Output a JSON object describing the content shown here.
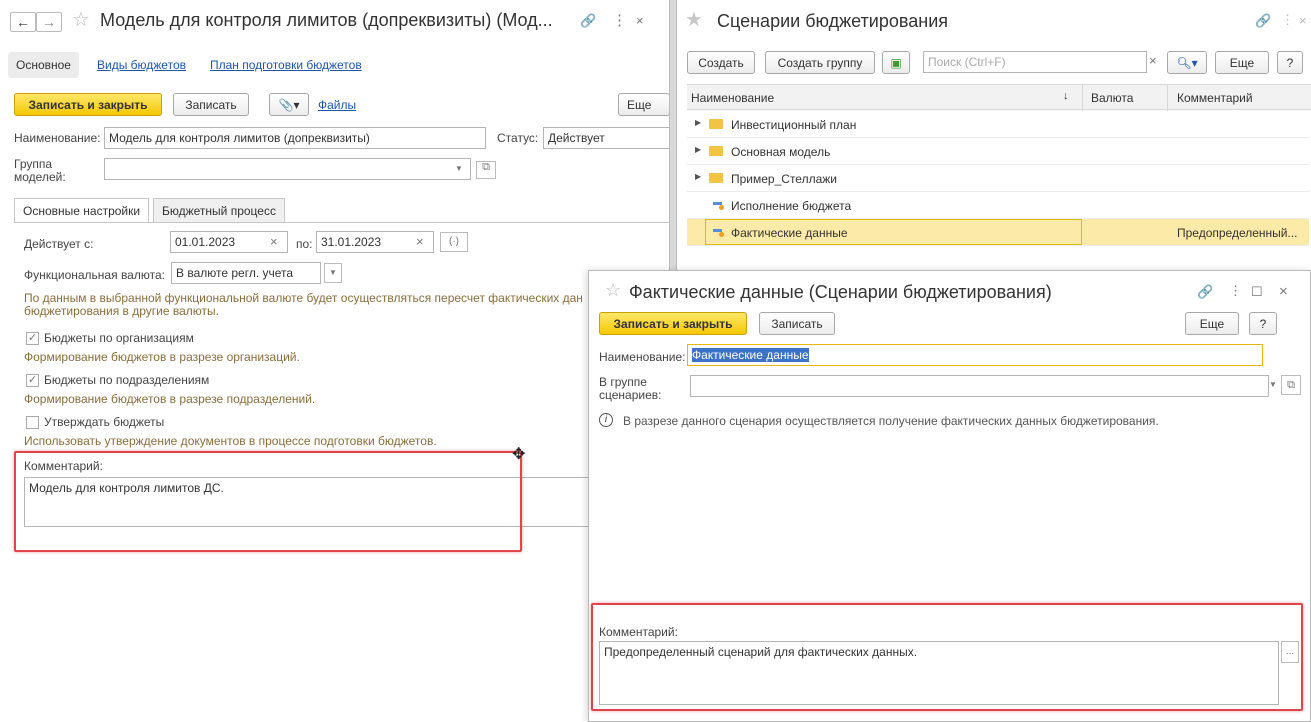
{
  "model_window": {
    "title": "Модель для контроля лимитов (допреквизиты) (Мод...",
    "nav_tabs": [
      "Основное",
      "Виды бюджетов",
      "План подготовки бюджетов"
    ],
    "toolbar": {
      "save_close": "Записать и закрыть",
      "save": "Записать",
      "files": "Файлы",
      "more": "Еще"
    },
    "name_label": "Наименование:",
    "name_value": "Модель для контроля лимитов (допреквизиты)",
    "status_label": "Статус:",
    "status_value": "Действует",
    "group_label_1": "Группа",
    "group_label_2": "моделей:",
    "group_value": "",
    "tabs": [
      "Основные настройки",
      "Бюджетный процесс"
    ],
    "active_from_label": "Действует с:",
    "date_from": "01.01.2023",
    "to_label": "по:",
    "date_to": "31.01.2023",
    "currency_label": "Функциональная валюта:",
    "currency_value": "В валюте регл. учета",
    "currency_hint_1": "По данным в выбранной функциональной валюте будет осуществляться пересчет фактических дан",
    "currency_hint_2": "бюджетирования в другие валюты.",
    "check_orgs_label": "Бюджеты по организациям",
    "check_orgs_hint": "Формирование бюджетов в разрезе организаций.",
    "check_depts_label": "Бюджеты по подразделениям",
    "check_depts_hint": "Формирование бюджетов в разрезе подразделений.",
    "check_approve_label": "Утверждать бюджеты",
    "check_approve_hint": "Использовать утверждение документов в процессе подготовки бюджетов.",
    "comment_label": "Комментарий:",
    "comment_value": "Модель для контроля лимитов ДС."
  },
  "scenarios_window": {
    "title": "Сценарии бюджетирования",
    "toolbar": {
      "create": "Создать",
      "create_group": "Создать группу",
      "search_placeholder": "Поиск (Ctrl+F)",
      "more": "Еще",
      "help": "?"
    },
    "columns": [
      "Наименование",
      "Валюта",
      "Комментарий"
    ],
    "rows": [
      {
        "name": "Инвестиционный план",
        "currency": "",
        "comment": ""
      },
      {
        "name": "Основная модель",
        "currency": "",
        "comment": ""
      },
      {
        "name": "Пример_Стеллажи",
        "currency": "",
        "comment": ""
      },
      {
        "name": "Исполнение бюджета",
        "currency": "",
        "comment": ""
      },
      {
        "name": "Фактические данные",
        "currency": "",
        "comment": "Предопределенный..."
      }
    ]
  },
  "fact_window": {
    "title": "Фактические данные (Сценарии бюджетирования)",
    "toolbar": {
      "save_close": "Записать и закрыть",
      "save": "Записать",
      "more": "Еще",
      "help": "?"
    },
    "name_label": "Наименование:",
    "name_value": "Фактические данные",
    "group_label_1": "В группе",
    "group_label_2": "сценариев:",
    "group_value": "",
    "info_text": "В разрезе данного сценария осуществляется получение фактических данных бюджетирования.",
    "comment_label": "Комментарий:",
    "comment_value": "Предопределенный сценарий для фактических данных."
  },
  "colors": {
    "accent_yellow": "#f5c805",
    "highlight_red": "#e0454a",
    "link_blue": "#1c55b0",
    "hint_brown": "#8a6d3b"
  }
}
